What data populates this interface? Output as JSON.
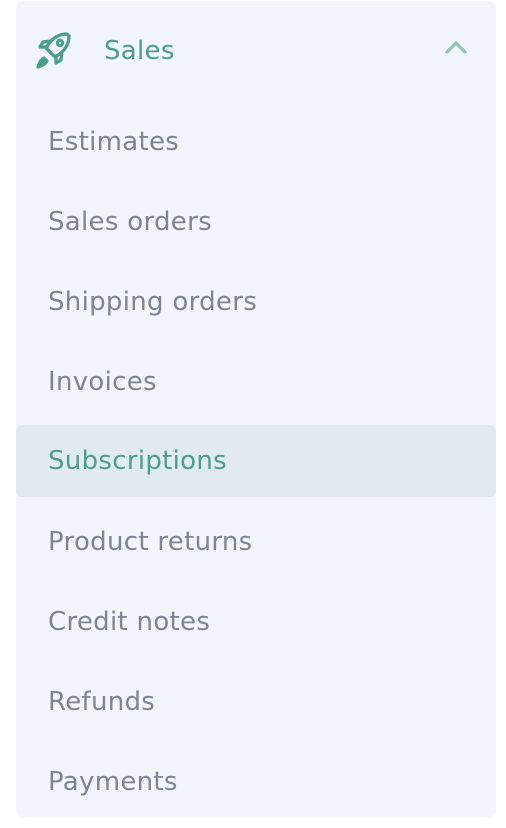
{
  "section": {
    "title": "Sales",
    "icon": "rocket-icon",
    "expanded": true,
    "accent_color": "#4a9f8a",
    "text_color": "#7c8595",
    "panel_color": "#f2f5fc",
    "active_bg_color": "#e1ebef"
  },
  "items": [
    {
      "label": "Estimates",
      "active": false
    },
    {
      "label": "Sales orders",
      "active": false
    },
    {
      "label": "Shipping orders",
      "active": false
    },
    {
      "label": "Invoices",
      "active": false
    },
    {
      "label": "Subscriptions",
      "active": true
    },
    {
      "label": "Product returns",
      "active": false
    },
    {
      "label": "Credit notes",
      "active": false
    },
    {
      "label": "Refunds",
      "active": false
    },
    {
      "label": "Payments",
      "active": false
    }
  ]
}
